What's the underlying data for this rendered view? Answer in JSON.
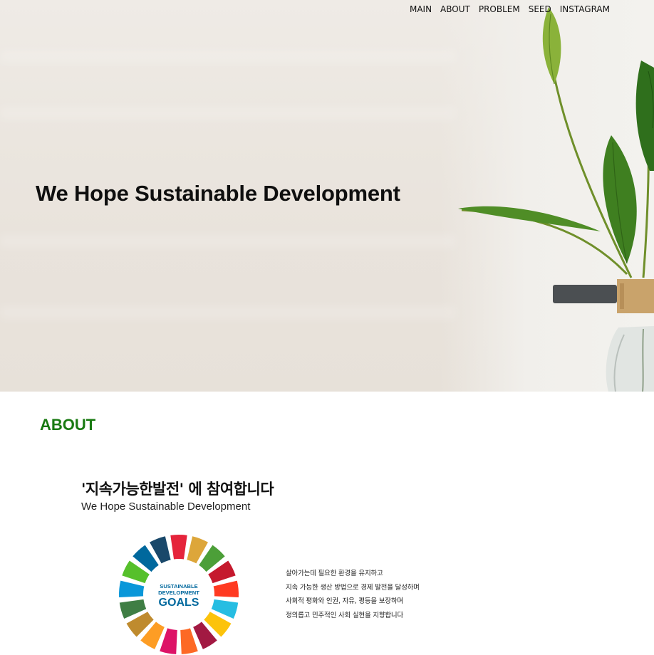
{
  "nav": {
    "items": [
      {
        "label": "MAIN"
      },
      {
        "label": "ABOUT"
      },
      {
        "label": "PROBLEM"
      },
      {
        "label": "SEED"
      },
      {
        "label": "INSTAGRAM"
      }
    ]
  },
  "hero": {
    "title": "We Hope Sustainable Development",
    "image_description_icon": "plant-in-glass-vase-icon"
  },
  "about": {
    "heading": "ABOUT",
    "heading_color": "#197a12",
    "title_kr": "'지속가능한발전' 에 참여합니다",
    "subtitle_en": "We Hope Sustainable Development",
    "sdg_logo": {
      "line1": "SUSTAINABLE",
      "line2": "DEVELOPMENT",
      "line3": "GOALS"
    },
    "description": [
      "살아가는데 필요한 환경을 유지하고",
      "지속 가능한 생산 방법으로 경제 발전을 달성하며",
      "사회적 평화와 인권, 자유, 평등을 보장하며",
      "정의롭고 민주적인 사회 실현을 지향합니다"
    ]
  },
  "colors": {
    "sdg_segments": [
      "#e5243b",
      "#dda63a",
      "#4c9f38",
      "#c5192d",
      "#ff3a21",
      "#26bde2",
      "#fcc30b",
      "#a21942",
      "#fd6925",
      "#dd1367",
      "#fd9d24",
      "#bf8b2e",
      "#3f7e44",
      "#0a97d9",
      "#56c02b",
      "#00689d",
      "#19486a"
    ]
  }
}
